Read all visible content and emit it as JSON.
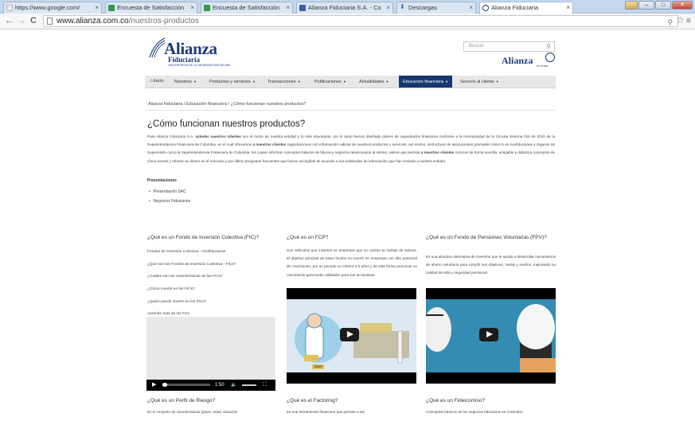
{
  "browser": {
    "tabs": [
      {
        "title": "https://www.google.com/",
        "active": false
      },
      {
        "title": "Encuesta de Satisfacción",
        "active": false
      },
      {
        "title": "Encuesta de Satisfacción",
        "active": false
      },
      {
        "title": "Alianza Fiduciaria S.A. - Co",
        "active": false
      },
      {
        "title": "Descargas",
        "active": false
      },
      {
        "title": "Alianza Fiduciaria",
        "active": true
      }
    ],
    "address_domain": "www.alianza.com.co",
    "address_path": "/nuestros-productos"
  },
  "header": {
    "logo_main": "Alianza",
    "logo_sub": "Fiduciaria",
    "logo_tiny": "UNA EMPRESA DE LA ORGANIZACIÓN DELIMA",
    "search_placeholder": "Buscar",
    "logo2_main": "Alianza",
    "logo2_tag": "en línea"
  },
  "nav": {
    "items": [
      {
        "label": "Inicio"
      },
      {
        "label": "Nosotros"
      },
      {
        "label": "Productos y servicios"
      },
      {
        "label": "Transacciones"
      },
      {
        "label": "Publicaciones"
      },
      {
        "label": "Actualidades"
      },
      {
        "label": "Educación financiera"
      },
      {
        "label": "Servicio al cliente"
      }
    ]
  },
  "breadcrumb": "Alianza Fiduciaria / Educación financiera / ¿Cómo funcionan nuestros productos?",
  "main": {
    "title": "¿Cómo funcionan nuestros productos?",
    "intro_pre": "Para Alianza Fiduciaria S.A. ",
    "intro_b1": "ustedes nuestros clientes",
    "intro_mid": " son el motor de nuestra entidad y lo más importante, por lo tanto hemos diseñado planes de capacitación financiera conforme a la normatividad de la Circular Externa 015 de 2010 de la Superintendencia Financiera de Colombia, en el cual ofrecemos ",
    "intro_b2": "a nuestros clientes",
    "intro_mid2": " capacitaciones con información valiosa de nuestros productos y servicios, así mismo, instructivos de asociaciones gremiales como lo es Asofiduciarias y órganos de Supervisión como la Superintendencia Financiera de Colombia, los cuales informan conceptos básicos de fiducia y negocios relacionados al mismo, videos que permita ",
    "intro_b3": "a nuestros clientes",
    "intro_post": " conocer de forma sencilla, amigable y didáctica conceptos de cómo invertir y ahorrar su dinero en el mercado y por último preguntas frecuentes que fueron escogidas de acuerdo a sus solicitudes de información que han enviado a nuestra entidad.",
    "presentaciones_label": "Presentaciones",
    "presentaciones": [
      "Presentación SAC",
      "Negocios Fiduciarios"
    ]
  },
  "columns": {
    "fic": {
      "heading": "¿Qué es un Fondo de Inversión Colectiva (FIC)?",
      "links": [
        "Fondos de Inversión Colectiva - Asofiduciarias",
        "¿Qué son los Fondos de Inversión Colectiva - FICs?",
        "¿Cuáles son las características de los FICs?",
        "¿Cómo invertir en los FICs?",
        "¿Quién puede invertir en los FICs?",
        "Aprende mas de los Fics"
      ],
      "video_time": "1:50"
    },
    "fcp": {
      "heading": "¿Qué es un FCP?",
      "text": "Son vehículos que invierten en empresas que no cotizan en bolsas de valores. El objetivo principal de estos fondos es invertir en empresas con alto potencial de crecimiento, por un periodo no inferior a 5 años y de esta forma promover su crecimiento generando utilidades para sus accionistas.",
      "video_caption": "Juan"
    },
    "fpv": {
      "heading": "¿Qué es un Fondo de Pensiones Voluntarias (FPV)?",
      "text": "Es una atractiva alternativa de inversión que le ayuda a desarrollar mecanismos de ahorro voluntario para cumplir sus objetivos, metas y sueños, mejorando su calidad de vida y seguridad pensional."
    }
  },
  "bottom": {
    "riesgo": {
      "heading": "¿Qué es un Perfil de Riesgo?",
      "text": "Es el conjunto de características (plazo, edad, situación"
    },
    "factoring": {
      "heading": "¿Qué es el Factoring?",
      "text": "Es una herramienta financiera que permite a las"
    },
    "fideicomiso": {
      "heading": "¿Qué es un Fideicomiso?",
      "text": "Conceptos básicos de los negocios fiduciarios en Colombia -"
    }
  },
  "colors": {
    "brand": "#1d3a7a",
    "nav_active": "#15366e"
  }
}
